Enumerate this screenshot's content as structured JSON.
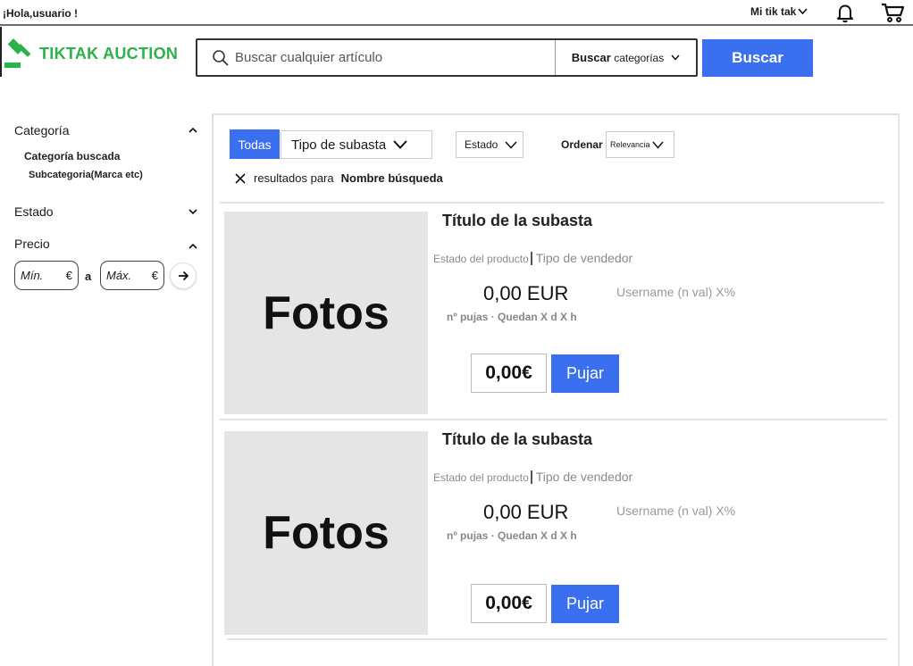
{
  "topbar": {
    "greeting": "¡Hola,usuario !",
    "account_menu": "Mi tik tak",
    "notifications_icon": "bell-icon",
    "cart_icon": "cart-icon"
  },
  "header": {
    "logo_text": "TIKTAK AUCTION",
    "search_placeholder": "Buscar cualquier artículo",
    "category_bold": "Buscar",
    "category_rest": "categorías",
    "search_button": "Buscar"
  },
  "sidebar": {
    "category_title": "Categoría",
    "category_searched": "Categoría buscada",
    "subcategory": "Subcategoria(Marca etc)",
    "estado_title": "Estado",
    "precio_title": "Precio",
    "min_label": "Mín.",
    "max_label": "Máx.",
    "currency": "€",
    "range_sep": "a"
  },
  "filters": {
    "all_tab": "Todas",
    "auction_type": "Tipo de subasta",
    "state": "Estado",
    "sort_label": "Ordenar",
    "sort_value": "Relevancia"
  },
  "results": {
    "text_prefix": "resultados para",
    "query": "Nombre búsqueda"
  },
  "listings": [
    {
      "photo_label": "Fotos",
      "title": "Título de la subasta",
      "product_state": "Estado del producto",
      "seller_type": "Tipo de vendedor",
      "price": "0,00 EUR",
      "bids_info": "nº pujas · Quedan X d  X h",
      "seller": "Username (n val) X%",
      "bid_value": "0,00€",
      "bid_button": "Pujar"
    },
    {
      "photo_label": "Fotos",
      "title": "Título de la subasta",
      "product_state": "Estado del producto",
      "seller_type": "Tipo de vendedor",
      "price": "0,00 EUR",
      "bids_info": "nº pujas · Quedan X d  X h",
      "seller": "Username (n val) X%",
      "bid_value": "0,00€",
      "bid_button": "Pujar"
    }
  ],
  "colors": {
    "accent": "#3a6ff0",
    "brand": "#2bb34a",
    "photo_bg": "#e5e5e5"
  }
}
